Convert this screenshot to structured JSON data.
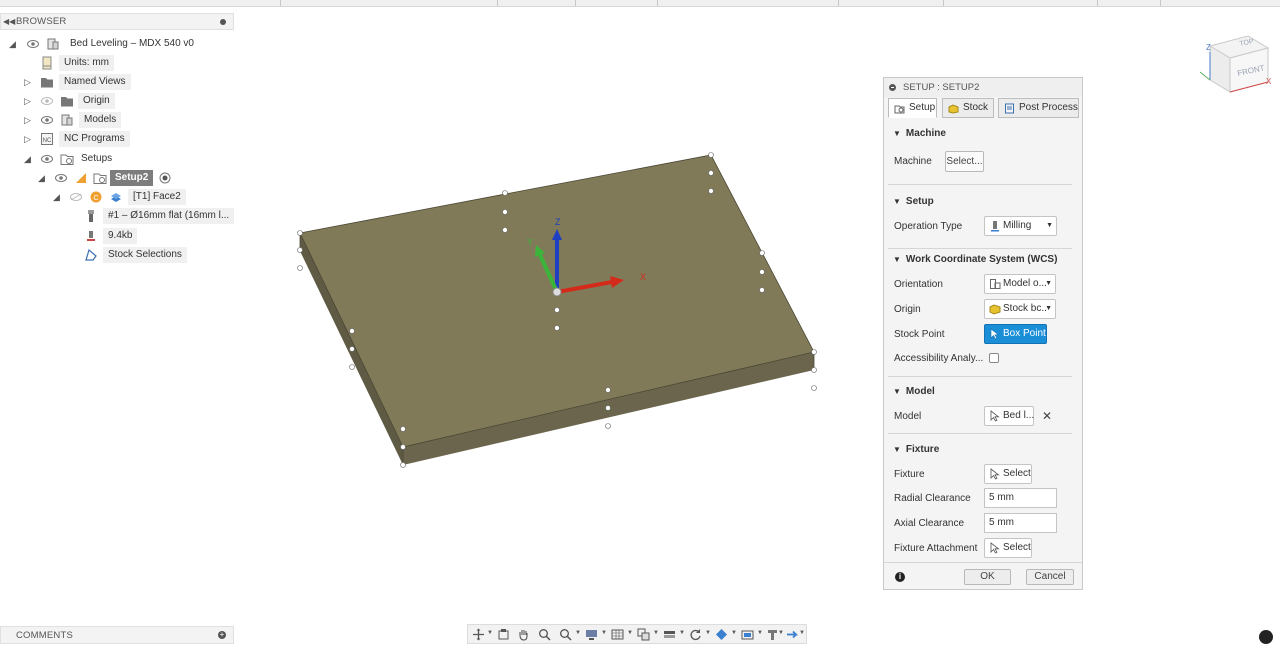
{
  "browser": {
    "title": "BROWSER",
    "tree": [
      {
        "label": "Bed Leveling – MDX 540 v0"
      },
      {
        "label": "Units: mm"
      },
      {
        "label": "Named Views"
      },
      {
        "label": "Origin"
      },
      {
        "label": "Models"
      },
      {
        "label": "NC Programs"
      },
      {
        "label": "Setups"
      },
      {
        "label": "Setup2"
      },
      {
        "label": "[T1] Face2"
      },
      {
        "label": "#1 – Ø16mm flat (16mm l..."
      },
      {
        "label": "9.4kb"
      },
      {
        "label": "Stock Selections"
      }
    ]
  },
  "comments": {
    "title": "COMMENTS"
  },
  "viewcube": {
    "top": "TOP",
    "front": "FRONT",
    "axis_x": "X",
    "axis_z": "Z"
  },
  "triad": {
    "x": "X",
    "y": "Y",
    "z": "Z"
  },
  "dialog": {
    "title": "SETUP : SETUP2",
    "tabs": [
      {
        "label": "Setup",
        "icon": "setup-icon"
      },
      {
        "label": "Stock",
        "icon": "stock-icon"
      },
      {
        "label": "Post Process",
        "icon": "post-process-icon"
      }
    ],
    "machine": {
      "section": "Machine",
      "label": "Machine",
      "button": "Select..."
    },
    "setup": {
      "section": "Setup",
      "operation_type_label": "Operation Type",
      "operation_type_value": "Milling"
    },
    "wcs": {
      "section": "Work Coordinate System (WCS)",
      "orientation_label": "Orientation",
      "orientation_value": "Model o...",
      "origin_label": "Origin",
      "origin_value": "Stock bc...",
      "stock_point_label": "Stock Point",
      "stock_point_value": "Box Point",
      "accessibility_label": "Accessibility Analy..."
    },
    "model": {
      "section": "Model",
      "label": "Model",
      "value": "Bed l..."
    },
    "fixture": {
      "section": "Fixture",
      "fixture_label": "Fixture",
      "fixture_button": "Select",
      "radial_label": "Radial Clearance",
      "radial_value": "5 mm",
      "axial_label": "Axial Clearance",
      "axial_value": "5 mm",
      "attachment_label": "Fixture Attachment",
      "attachment_button": "Select"
    },
    "ok": "OK",
    "cancel": "Cancel"
  },
  "colors": {
    "accent": "#1b8ed8",
    "stock_top": "#807a58",
    "stock_front": "#6a654c",
    "stock_side": "#5e5a44"
  }
}
